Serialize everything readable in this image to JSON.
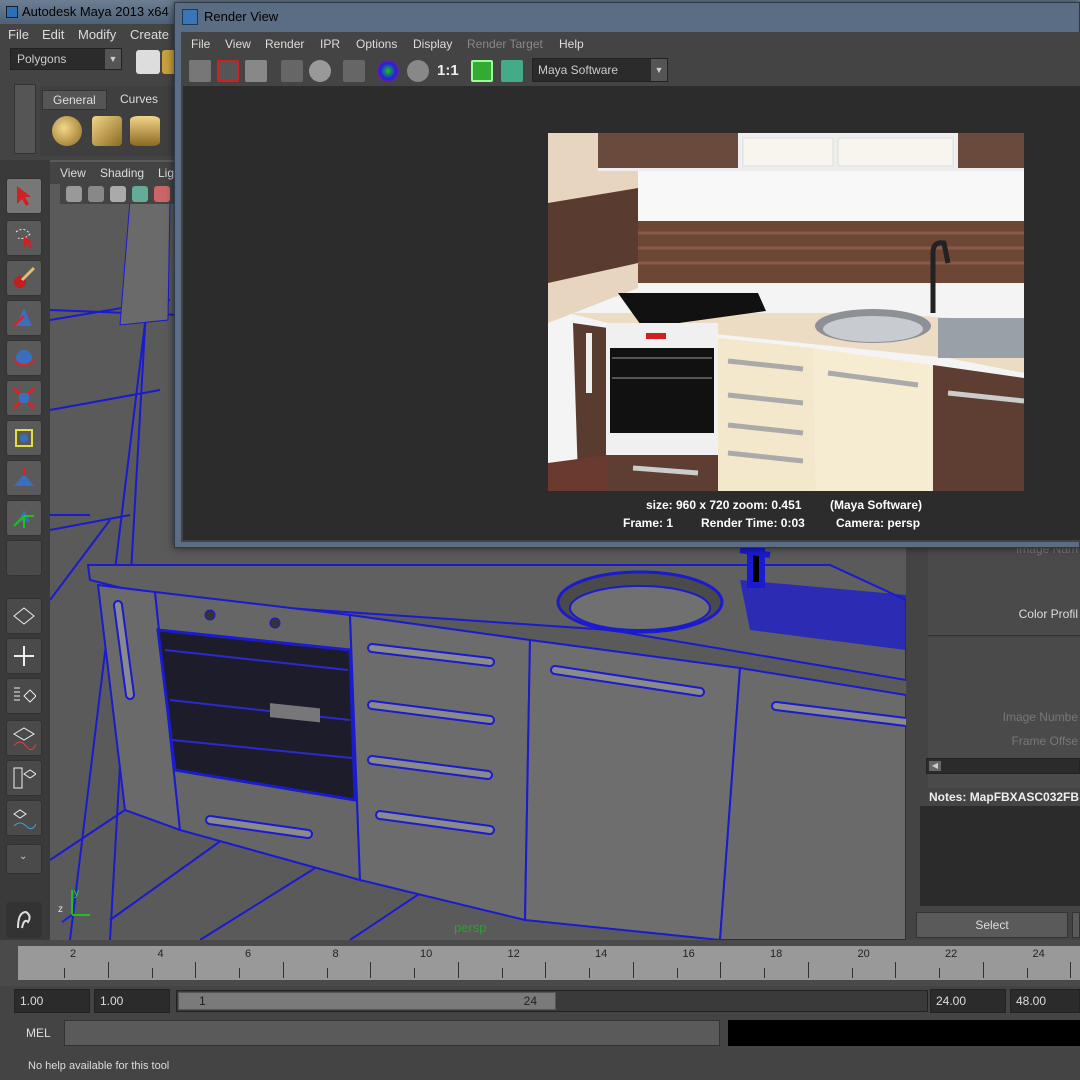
{
  "app_title": "Autodesk Maya 2013 x64",
  "main_menu": [
    "File",
    "Edit",
    "Modify",
    "Create"
  ],
  "mode_select": "Polygons",
  "shelf_tabs": [
    "General",
    "Curves"
  ],
  "viewport_menu": [
    "View",
    "Shading",
    "Lig"
  ],
  "camera_label": "persp",
  "attr_panel": {
    "image_name": "Image Nam",
    "color_profile": "Color Profil",
    "image_number": "Image Numbe",
    "frame_offset": "Frame Offse",
    "notes_label": "Notes:",
    "notes_value": "MapFBXASC032FB",
    "select_button": "Select"
  },
  "timeline": {
    "ticks": [
      "2",
      "4",
      "6",
      "8",
      "10",
      "12",
      "14",
      "16",
      "18",
      "20",
      "22",
      "24"
    ],
    "start": "1.00",
    "playback_start": "1.00",
    "range_start": "1",
    "range_end": "24",
    "playback_end": "24.00",
    "end": "48.00"
  },
  "command_line": {
    "label": "MEL"
  },
  "help_line": "No help available for this tool",
  "render_view": {
    "title": "Render View",
    "menu": [
      "File",
      "View",
      "Render",
      "IPR",
      "Options",
      "Display",
      "Render Target",
      "Help"
    ],
    "ratio_label": "1:1",
    "renderer": "Maya Software",
    "info_size": "size: 960 x 720 zoom: 0.451",
    "info_renderer": "(Maya Software)",
    "info_frame": "Frame: 1",
    "info_time": "Render Time: 0:03",
    "info_camera": "Camera: persp"
  },
  "colors": {
    "accent_blue": "#1a1ad0",
    "title_bar": "#5a6d84"
  }
}
